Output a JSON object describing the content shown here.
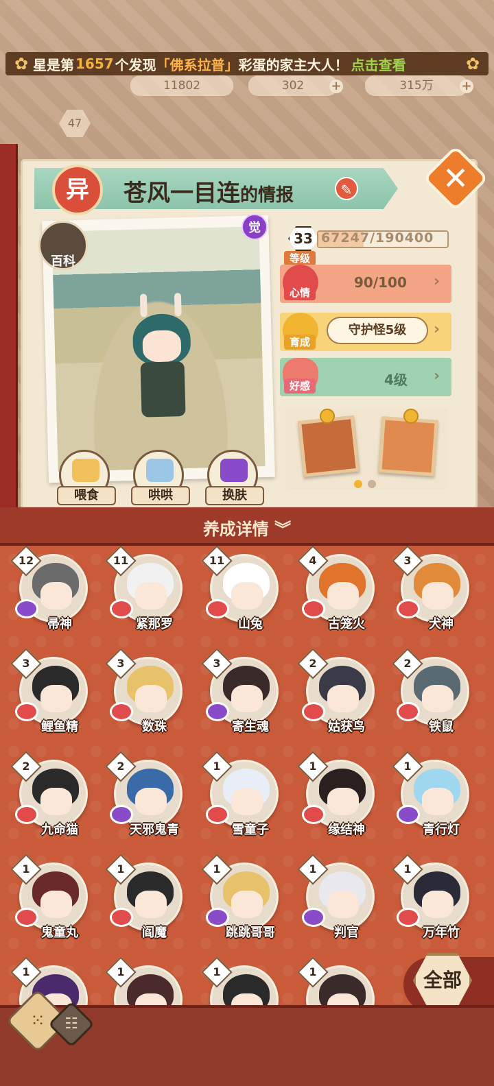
{
  "banner": {
    "prefix": "星是第",
    "count": "1657",
    "middle": "个发现",
    "egg_name": "「佛系拉普」",
    "suffix": "彩蛋的家主大人！",
    "link": "点击查看"
  },
  "resources": {
    "r1": "11802",
    "r2": "302",
    "r3": "315万",
    "player_level": "47"
  },
  "card": {
    "rarity": "异",
    "name": "苍风一目连",
    "name_suffix": "的情报",
    "baike": "百科",
    "awaken": "觉"
  },
  "stats": {
    "level": "33",
    "level_label": "等级",
    "exp_text": "67247/190400",
    "exp_fraction": 0.353,
    "mood_label": "心情",
    "mood_value": "90/100",
    "growth_label": "育成",
    "growth_value": "守护怪5级",
    "favor_label": "好感",
    "favor_value": "4级"
  },
  "actions": {
    "feed": "喂食",
    "soothe": "哄哄",
    "skin": "换肤"
  },
  "details_title": "养成详情",
  "all_button": "全部",
  "shikigami": [
    {
      "name": "帚神",
      "level": "12",
      "hair": "#6b6b6b",
      "heart": "#8a4bc8"
    },
    {
      "name": "紧那罗",
      "level": "11",
      "hair": "#f1f1f1",
      "heart": "#e24b4b"
    },
    {
      "name": "山兔",
      "level": "11",
      "hair": "#ffffff",
      "heart": "#e24b4b"
    },
    {
      "name": "古笼火",
      "level": "4",
      "hair": "#e0742d",
      "heart": "#e24b4b"
    },
    {
      "name": "犬神",
      "level": "3",
      "hair": "#e08a3a",
      "heart": "#e24b4b"
    },
    {
      "name": "鲤鱼精",
      "level": "3",
      "hair": "#2a2a2a",
      "heart": "#e24b4b"
    },
    {
      "name": "数珠",
      "level": "3",
      "hair": "#e8c26a",
      "heart": "#e24b4b"
    },
    {
      "name": "寄生魂",
      "level": "3",
      "hair": "#3b2a2a",
      "heart": "#8a4bc8"
    },
    {
      "name": "姑获鸟",
      "level": "2",
      "hair": "#3a3a48",
      "heart": "#e24b4b"
    },
    {
      "name": "铁鼠",
      "level": "2",
      "hair": "#5a6a72",
      "heart": "#e24b4b"
    },
    {
      "name": "九命猫",
      "level": "2",
      "hair": "#2a2a2a",
      "heart": "#e24b4b"
    },
    {
      "name": "天邪鬼青",
      "level": "2",
      "hair": "#3a6aa8",
      "heart": "#8a4bc8"
    },
    {
      "name": "雪童子",
      "level": "1",
      "hair": "#e8eef8",
      "heart": "#e24b4b"
    },
    {
      "name": "缘结神",
      "level": "1",
      "hair": "#2a2020",
      "heart": "#e24b4b"
    },
    {
      "name": "青行灯",
      "level": "1",
      "hair": "#9fd8ee",
      "heart": "#8a4bc8"
    },
    {
      "name": "鬼童丸",
      "level": "1",
      "hair": "#6a2a2a",
      "heart": "#e24b4b"
    },
    {
      "name": "阎魔",
      "level": "1",
      "hair": "#2a2a2a",
      "heart": "#e24b4b"
    },
    {
      "name": "跳跳哥哥",
      "level": "1",
      "hair": "#e8c26a",
      "heart": "#8a4bc8"
    },
    {
      "name": "判官",
      "level": "1",
      "hair": "#e8e8ee",
      "heart": "#8a4bc8"
    },
    {
      "name": "万年竹",
      "level": "1",
      "hair": "#2a2a38",
      "heart": "#e24b4b"
    },
    {
      "name": "",
      "level": "1",
      "hair": "#4a2a6a",
      "heart": "#e24b4b"
    },
    {
      "name": "",
      "level": "1",
      "hair": "#4a2a2a",
      "heart": "#e24b4b"
    },
    {
      "name": "",
      "level": "1",
      "hair": "#2a2a2a",
      "heart": "#e24b4b"
    },
    {
      "name": "",
      "level": "1",
      "hair": "#3a2a2a",
      "heart": "#e24b4b"
    }
  ]
}
